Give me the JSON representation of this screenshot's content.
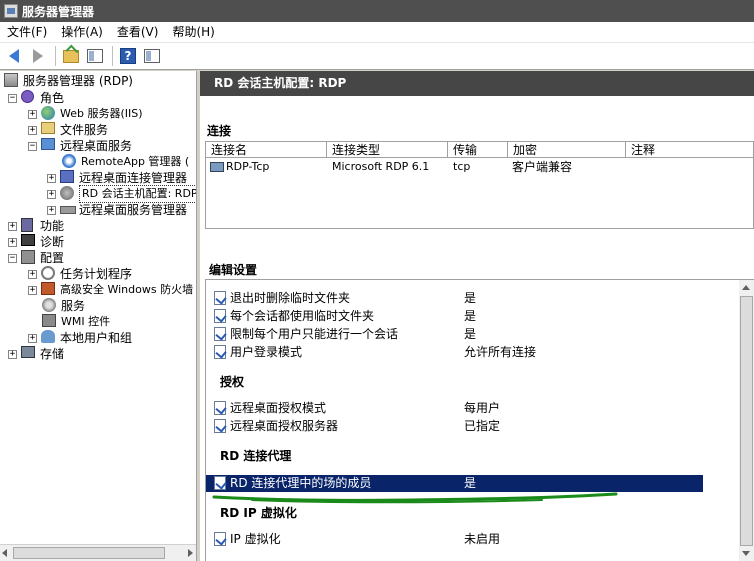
{
  "window": {
    "title": "服务器管理器"
  },
  "menu": [
    "文件(F)",
    "操作(A)",
    "查看(V)",
    "帮助(H)"
  ],
  "tree": {
    "root": "服务器管理器 (RDP)",
    "roles": "角色",
    "web_server": "Web 服务器(IIS)",
    "file_services": "文件服务",
    "rds": "远程桌面服务",
    "remoteapp": "RemoteApp 管理器 (",
    "conn_broker": "远程桌面连接管理器",
    "session_host": "RD 会话主机配置: RDP",
    "rds_manager": "远程桌面服务管理器",
    "features": "功能",
    "diagnostics": "诊断",
    "configuration": "配置",
    "task_scheduler": "任务计划程序",
    "firewall": "高级安全 Windows 防火墙",
    "services": "服务",
    "wmi": "WMI 控件",
    "local_users": "本地用户和组",
    "storage": "存储"
  },
  "main": {
    "header": "RD 会话主机配置: RDP",
    "connections_title": "连接",
    "columns": [
      "连接名",
      "连接类型",
      "传输",
      "加密",
      "注释"
    ],
    "connection": {
      "name": "RDP-Tcp",
      "type": "Microsoft RDP 6.1",
      "transport": "tcp",
      "encryption": "客户端兼容",
      "comment": ""
    },
    "edit_settings_title": "编辑设置",
    "general": [
      {
        "name": "退出时删除临时文件夹",
        "value": "是"
      },
      {
        "name": "每个会话都使用临时文件夹",
        "value": "是"
      },
      {
        "name": "限制每个用户只能进行一个会话",
        "value": "是"
      },
      {
        "name": "用户登录模式",
        "value": "允许所有连接"
      }
    ],
    "licensing_title": "授权",
    "licensing": [
      {
        "name": "远程桌面授权模式",
        "value": "每用户"
      },
      {
        "name": "远程桌面授权服务器",
        "value": "已指定"
      }
    ],
    "broker_title": "RD 连接代理",
    "broker": [
      {
        "name": "RD 连接代理中的场的成员",
        "value": "是"
      }
    ],
    "ipv_title": "RD IP 虚拟化",
    "ipv": [
      {
        "name": "IP 虚拟化",
        "value": "未启用"
      }
    ]
  },
  "colors": {
    "header_bg": "#464646",
    "selection": "#0a246a",
    "annotation": "#1a8a1a"
  }
}
